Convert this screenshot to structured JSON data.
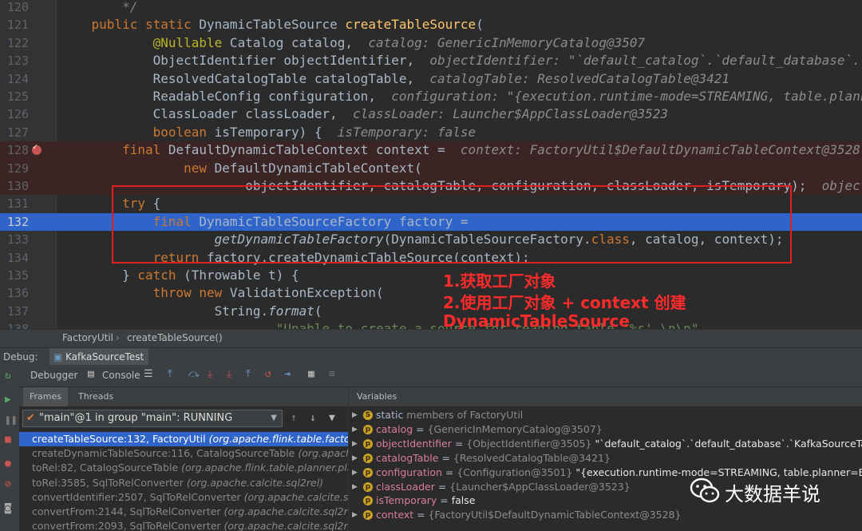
{
  "editor": {
    "lines": [
      {
        "num": "120",
        "tokens": [
          {
            "t": "        */",
            "c": "cmt"
          }
        ]
      },
      {
        "num": "121",
        "tokens": [
          {
            "t": "    public static ",
            "c": "kw"
          },
          {
            "t": "DynamicTableSource "
          },
          {
            "t": "createTableSource",
            "c": "fn"
          },
          {
            "t": "("
          }
        ]
      },
      {
        "num": "122",
        "tokens": [
          {
            "t": "            "
          },
          {
            "t": "@Nullable",
            "c": "ann"
          },
          {
            "t": " Catalog catalog,  "
          },
          {
            "t": "catalog: GenericInMemoryCatalog@3507",
            "c": "inl"
          }
        ]
      },
      {
        "num": "123",
        "tokens": [
          {
            "t": "            ObjectIdentifier objectIdentifier,  "
          },
          {
            "t": "objectIdentifier: \"`default_catalog`.`default_database`.`Ka",
            "c": "inl"
          }
        ]
      },
      {
        "num": "124",
        "tokens": [
          {
            "t": "            ResolvedCatalogTable catalogTable,  "
          },
          {
            "t": "catalogTable: ResolvedCatalogTable@3421",
            "c": "inl"
          }
        ]
      },
      {
        "num": "125",
        "tokens": [
          {
            "t": "            ReadableConfig configuration,  "
          },
          {
            "t": "configuration: \"{execution.runtime-mode=STREAMING, table.planner",
            "c": "inl"
          }
        ]
      },
      {
        "num": "126",
        "tokens": [
          {
            "t": "            ClassLoader classLoader,  "
          },
          {
            "t": "classLoader: Launcher$AppClassLoader@3523",
            "c": "inl"
          }
        ]
      },
      {
        "num": "127",
        "tokens": [
          {
            "t": "            "
          },
          {
            "t": "boolean",
            "c": "kw"
          },
          {
            "t": " isTemporary) {  "
          },
          {
            "t": "isTemporary: false",
            "c": "inl"
          }
        ]
      },
      {
        "num": "128",
        "highlight": "red",
        "breakpoint": true,
        "tokens": [
          {
            "t": "        "
          },
          {
            "t": "final",
            "c": "kw"
          },
          {
            "t": " DefaultDynamicTableContext context =  "
          },
          {
            "t": "context: FactoryUtil$DefaultDynamicTableContext@3528",
            "c": "inl"
          }
        ]
      },
      {
        "num": "129",
        "highlight": "red",
        "tokens": [
          {
            "t": "                "
          },
          {
            "t": "new",
            "c": "kw"
          },
          {
            "t": " DefaultDynamicTableContext("
          }
        ]
      },
      {
        "num": "130",
        "highlight": "red",
        "tokens": [
          {
            "t": "                        objectIdentifier, catalogTable, configuration, classLoader, isTemporary);  "
          },
          {
            "t": "objectId",
            "c": "inl"
          }
        ]
      },
      {
        "num": "131",
        "tokens": [
          {
            "t": "        "
          },
          {
            "t": "try",
            "c": "kw"
          },
          {
            "t": " {"
          }
        ]
      },
      {
        "num": "132",
        "highlight": "blue",
        "tokens": [
          {
            "t": "            "
          },
          {
            "t": "final",
            "c": "kw"
          },
          {
            "t": " DynamicTableSourceFactory factory ="
          }
        ]
      },
      {
        "num": "133",
        "tokens": [
          {
            "t": "                    "
          },
          {
            "t": "getDynamicTableFactory",
            "c": "it"
          },
          {
            "t": "(DynamicTableSourceFactory."
          },
          {
            "t": "class",
            "c": "kw"
          },
          {
            "t": ", catalog, context);"
          }
        ]
      },
      {
        "num": "134",
        "tokens": [
          {
            "t": "            "
          },
          {
            "t": "return",
            "c": "kw"
          },
          {
            "t": " factory.createDynamicTableSource(context);"
          }
        ]
      },
      {
        "num": "135",
        "tokens": [
          {
            "t": "        } "
          },
          {
            "t": "catch",
            "c": "kw"
          },
          {
            "t": " (Throwable t) {"
          }
        ]
      },
      {
        "num": "136",
        "tokens": [
          {
            "t": "            "
          },
          {
            "t": "throw new",
            "c": "kw"
          },
          {
            "t": " ValidationException("
          }
        ]
      },
      {
        "num": "137",
        "tokens": [
          {
            "t": "                    String."
          },
          {
            "t": "format",
            "c": "it"
          },
          {
            "t": "("
          }
        ]
      },
      {
        "num": "138",
        "tokens": [
          {
            "t": "                            "
          },
          {
            "t": "\"Unable to create a source for reading table '%s'.\\n\\n\"",
            "c": "str"
          }
        ]
      }
    ]
  },
  "annotation": {
    "line1": "1.获取工厂对象",
    "line2": "2.使用工厂对象 + context 创建",
    "line3": "DynamicTableSource"
  },
  "breadcrumb": {
    "part1": "FactoryUtil",
    "sep": "›",
    "part2": "createTableSource()"
  },
  "debug": {
    "label": "Debug:",
    "session_tab": "KafkaSourceTest"
  },
  "toolbar": {
    "debugger_tab": "Debugger",
    "console_tab": "Console"
  },
  "frames_panel": {
    "tab_frames": "Frames",
    "tab_threads": "Threads",
    "thread_selector": "\"main\"@1 in group \"main\": RUNNING",
    "frames": [
      {
        "method": "createTableSource:132, FactoryUtil ",
        "pkg": "(org.apache.flink.table.factories)",
        "selected": true
      },
      {
        "method": "createDynamicTableSource:116, CatalogSourceTable ",
        "pkg": "(org.apache.flink.table.planner.plan.schema)"
      },
      {
        "method": "toRel:82, CatalogSourceTable ",
        "pkg": "(org.apache.flink.table.planner.plan.schema)"
      },
      {
        "method": "toRel:3585, SqlToRelConverter ",
        "pkg": "(org.apache.calcite.sql2rel)"
      },
      {
        "method": "convertIdentifier:2507, SqlToRelConverter ",
        "pkg": "(org.apache.calcite.sql2rel)"
      },
      {
        "method": "convertFrom:2144, SqlToRelConverter ",
        "pkg": "(org.apache.calcite.sql2rel)"
      },
      {
        "method": "convertFrom:2093, SqlToRelConverter ",
        "pkg": "(org.apache.calcite.sql2rel)"
      }
    ]
  },
  "variables_panel": {
    "title": "Variables",
    "items": [
      {
        "name": "static",
        "rest": " members of FactoryUtil",
        "static": true,
        "icon": "S"
      },
      {
        "name": "catalog",
        "type": "{GenericInMemoryCatalog@3507}",
        "value": "",
        "icon": "p"
      },
      {
        "name": "objectIdentifier",
        "type": "{ObjectIdentifier@3505}",
        "value": " \"`default_catalog`.`default_database`.`KafkaSourceTable`\"",
        "icon": "p"
      },
      {
        "name": "catalogTable",
        "type": "{ResolvedCatalogTable@3421}",
        "value": "",
        "icon": "p"
      },
      {
        "name": "configuration",
        "type": "{Configuration@3501}",
        "value": " \"{execution.runtime-mode=STREAMING, table.planner=BLINK}\"",
        "icon": "p"
      },
      {
        "name": "classLoader",
        "type": "{Launcher$AppClassLoader@3523}",
        "value": "",
        "icon": "p"
      },
      {
        "name": "isTemporary",
        "type": "",
        "value": "false",
        "icon": "p",
        "leaf": true
      },
      {
        "name": "context",
        "type": "{FactoryUtil$DefaultDynamicTableContext@3528}",
        "value": "",
        "icon": "p"
      }
    ]
  },
  "watermark": {
    "text": "大数据羊说",
    "logo": "wechat-logo"
  },
  "colors": {
    "selection": "#2f65ca",
    "breakpoint": "#c75450",
    "annotation_red": "#ff2a2a"
  }
}
